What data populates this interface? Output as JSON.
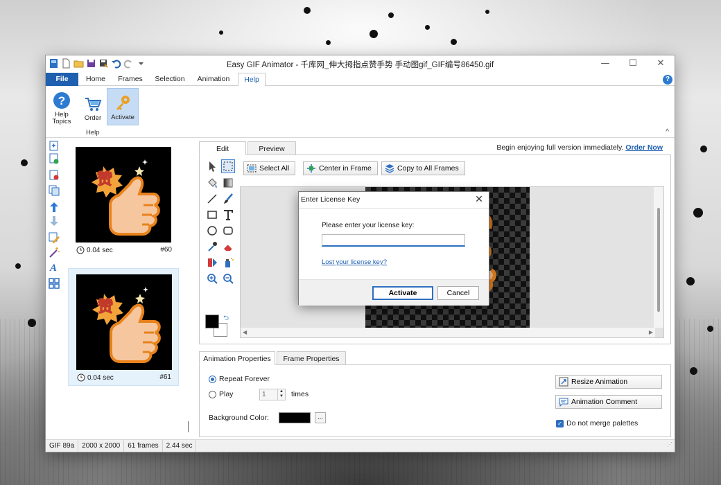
{
  "window": {
    "title": "Easy GIF Animator - 千库网_伸大拇指点赞手势 手动图gif_GIF编号86450.gif",
    "minimize": "—",
    "maximize": "☐",
    "close": "✕"
  },
  "menu": {
    "file": "File",
    "tabs": [
      "Home",
      "Frames",
      "Selection",
      "Animation",
      "Help"
    ],
    "help_icon": "?"
  },
  "ribbon": {
    "help_topics": "Help Topics",
    "order": "Order",
    "activate": "Activate",
    "group_label": "Help",
    "collapse": "^"
  },
  "frames": [
    {
      "duration": "0.04 sec",
      "number": "#60",
      "badge": "赞"
    },
    {
      "duration": "0.04 sec",
      "number": "#61",
      "badge": "赞"
    }
  ],
  "editor": {
    "tab_edit": "Edit",
    "tab_preview": "Preview",
    "promo_text": "Begin enjoying full version immediately.",
    "promo_link": "Order Now",
    "select_all": "Select All",
    "center_in_frame": "Center in Frame",
    "copy_to_all": "Copy to All Frames",
    "swap_icon": "⮌"
  },
  "dialog": {
    "title": "Enter License Key",
    "close": "✕",
    "prompt": "Please enter your license key:",
    "input_value": "",
    "lost_link": "Lost your license key?",
    "activate": "Activate",
    "cancel": "Cancel"
  },
  "properties": {
    "tab_animation": "Animation Properties",
    "tab_frame": "Frame Properties",
    "repeat_forever": "Repeat Forever",
    "play": "Play",
    "play_count": "1",
    "times": "times",
    "background_color_label": "Background Color:",
    "background_color": "#000000",
    "dots": "...",
    "resize_animation": "Resize Animation",
    "animation_comment": "Animation Comment",
    "no_merge": "Do not merge palettes"
  },
  "status": {
    "format": "GIF 89a",
    "size": "2000 x 2000",
    "frames": "61 frames",
    "duration": "2.44 sec"
  }
}
